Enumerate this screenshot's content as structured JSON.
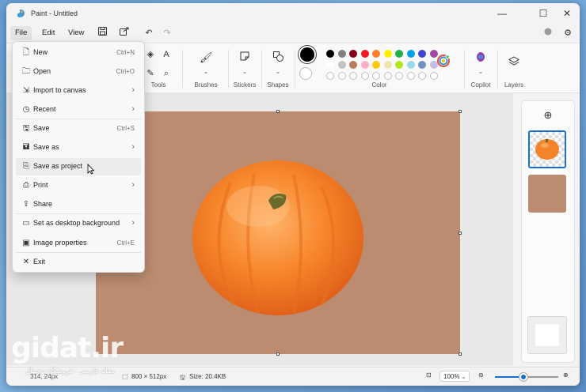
{
  "window": {
    "title": "Paint - Untitled",
    "minimize": "—",
    "maximize": "☐",
    "close": "✕"
  },
  "menubar": {
    "file": "File",
    "edit": "Edit",
    "view": "View"
  },
  "ribbon": {
    "tools_label": "Tools",
    "brushes_label": "Brushes",
    "stickers_label": "Stickers",
    "shapes_label": "Shapes",
    "color_label": "Color",
    "copilot_label": "Copilot",
    "layers_label": "Layers",
    "primary_color": "#000000",
    "secondary_color": "#ffffff",
    "palette_row1": [
      "#000000",
      "#7f7f7f",
      "#880015",
      "#ed1c24",
      "#ff7f27",
      "#fff200",
      "#22b14c",
      "#00a2e8",
      "#3f48cc",
      "#a349a4"
    ],
    "palette_row2": [
      "#ffffff",
      "#c3c3c3",
      "#b97a57",
      "#ffaec9",
      "#ffc90e",
      "#efe4b0",
      "#b5e61d",
      "#99d9ea",
      "#7092be",
      "#c8bfe7"
    ]
  },
  "file_menu": {
    "items": [
      {
        "label": "New",
        "shortcut": "Ctrl+N",
        "icon": "new-file-icon"
      },
      {
        "label": "Open",
        "shortcut": "Ctrl+O",
        "icon": "open-folder-icon"
      },
      {
        "label": "Import to canvas",
        "submenu": true,
        "icon": "import-icon"
      },
      {
        "label": "Recent",
        "submenu": true,
        "icon": "recent-clock-icon"
      },
      {
        "label": "Save",
        "shortcut": "Ctrl+S",
        "icon": "save-icon"
      },
      {
        "label": "Save as",
        "submenu": true,
        "icon": "save-as-icon"
      },
      {
        "label": "Save as project",
        "icon": "save-project-icon"
      },
      {
        "label": "Print",
        "submenu": true,
        "icon": "print-icon"
      },
      {
        "label": "Share",
        "icon": "share-icon"
      },
      {
        "label": "Set as desktop background",
        "submenu": true,
        "icon": "desktop-background-icon"
      },
      {
        "label": "Image properties",
        "shortcut": "Ctrl+E",
        "icon": "image-properties-icon"
      },
      {
        "label": "Exit",
        "icon": "exit-icon"
      }
    ]
  },
  "canvas": {
    "background_color": "#bc8c70"
  },
  "status": {
    "cursor_pos": "314, 24px",
    "canvas_size": "800 × 512px",
    "file_size": "Size: 20.4KB",
    "zoom": "100%",
    "zoom_level": 0.45
  },
  "watermark": {
    "logo": "gidat.ir",
    "subtitle": "مقاله فارسی - فروشگاه دیجیتال"
  }
}
